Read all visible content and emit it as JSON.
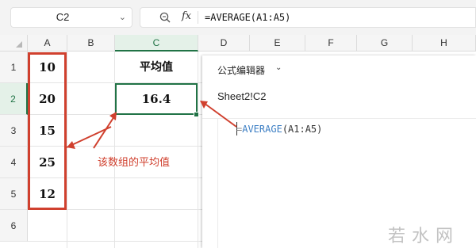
{
  "formula_bar": {
    "name_box": "C2",
    "name_box_dropdown_icon": "chevron-down-icon",
    "zoom_icon": "zoom-icon",
    "fx_label": "fx",
    "formula": "=AVERAGE(A1:A5)"
  },
  "columns": [
    "A",
    "B",
    "C",
    "D",
    "E",
    "F",
    "G",
    "H"
  ],
  "rows": [
    "1",
    "2",
    "3",
    "4",
    "5",
    "6"
  ],
  "selected_cell": {
    "column": "C",
    "row": "2"
  },
  "cells": {
    "A": [
      "10",
      "20",
      "15",
      "25",
      "12"
    ],
    "C1": "平均值",
    "C2": "16.4"
  },
  "annotation": "该数组的平均值",
  "formula_editor": {
    "title": "公式编辑器",
    "cell_ref": "Sheet2!C2",
    "formula_eq": "=",
    "formula_fn": "AVERAGE",
    "formula_args": "(A1:A5)"
  },
  "watermark": "若水网",
  "colors": {
    "selection": "#217346",
    "annotation": "#d0402e",
    "function_token": "#3d7fc4"
  }
}
